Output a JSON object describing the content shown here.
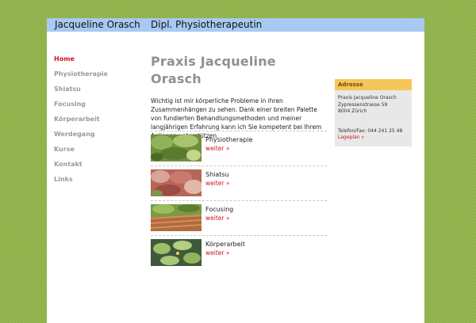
{
  "header": {
    "name": "Jacqueline Orasch",
    "title": "Dipl. Physiotherapeutin"
  },
  "nav": {
    "items": [
      {
        "label": "Home",
        "active": true
      },
      {
        "label": "Physiotherapie"
      },
      {
        "label": "Shiatsu"
      },
      {
        "label": "Focusing"
      },
      {
        "label": "Körperarbeit"
      },
      {
        "label": "Werdegang"
      },
      {
        "label": "Kurse"
      },
      {
        "label": "Kontakt"
      },
      {
        "label": "Links"
      }
    ]
  },
  "main": {
    "heading": "Praxis Jacqueline Orasch",
    "intro": "Wichtig ist mir körperliche Probleme in ihren Zusammenhängen zu sehen. Dank einer breiten Palette von fundierten Behandlungsmethoden und meiner langjährigen Erfahrung kann ich Sie kompetent bei Ihrem Anliegen unterstützen.",
    "entries": [
      {
        "label": "Physiotherapie",
        "more": "weiter »"
      },
      {
        "label": "Shiatsu",
        "more": "weiter »"
      },
      {
        "label": "Focusing",
        "more": "weiter »"
      },
      {
        "label": "Körperarbeit",
        "more": "weiter »"
      }
    ]
  },
  "address": {
    "heading": "Adresse",
    "name": "Praxis Jacqueline Orasch",
    "street": "Zypressenstrasse 59",
    "city": "8004 Zürich",
    "phone": "Telefon/Fax: 044 241 25 48",
    "map_link": "Lageplan »"
  },
  "colors": {
    "background": "#8fb048",
    "topbar": "#a7c9f2",
    "accent": "#d0141a",
    "address_head": "#f5c659"
  }
}
